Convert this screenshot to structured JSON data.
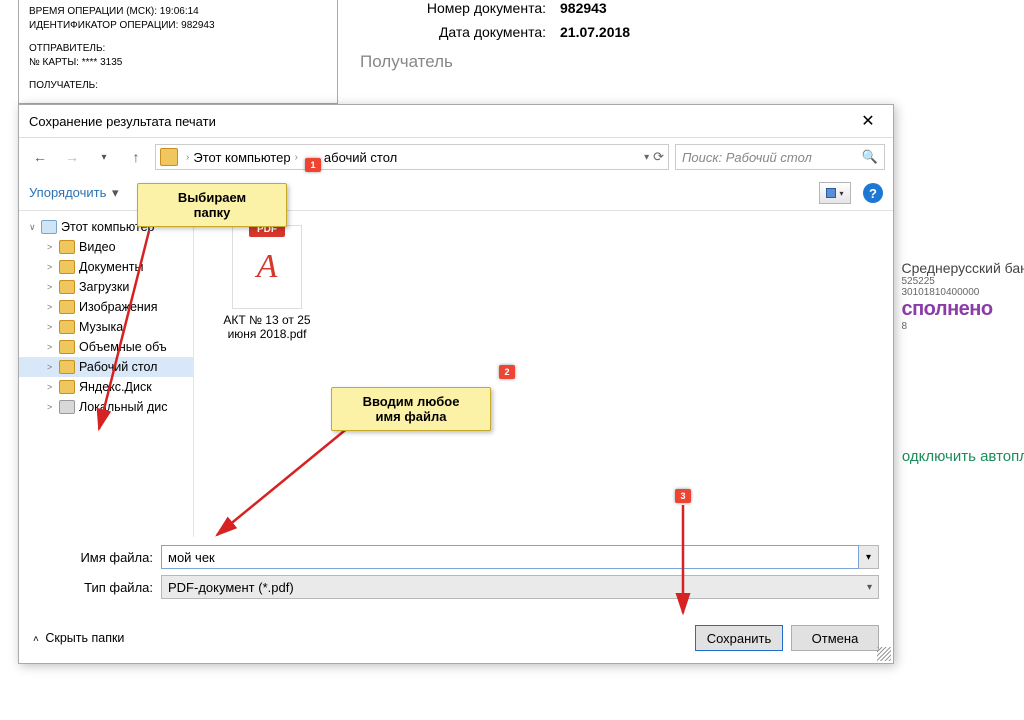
{
  "background": {
    "left_lines": {
      "time_label": "ВРЕМЯ ОПЕРАЦИИ (МСК): 19:06:14",
      "id_label": "ИДЕНТИФИКАТОР ОПЕРАЦИИ: 982943",
      "sender_label": "ОТПРАВИТЕЛЬ:",
      "card_label": "№ КАРТЫ: **** 3135",
      "recipient_label": "ПОЛУЧАТЕЛЬ:"
    },
    "right": {
      "doc_num_label": "Номер документа:",
      "doc_num": "982943",
      "doc_date_label": "Дата документа:",
      "doc_date": "21.07.2018",
      "recipient_heading": "Получатель"
    },
    "stamp": {
      "bank": "Среднерусский банк",
      "bic": "525225",
      "acct": "30101810400000",
      "status": "сполнено",
      "code": "8"
    },
    "autolink": "одключить автопл"
  },
  "dialog": {
    "title": "Сохранение результата печати",
    "breadcrumb": {
      "root": "Этот компьютер",
      "current": "абочий стол"
    },
    "search_placeholder": "Поиск: Рабочий стол",
    "organize": "Упорядочить",
    "tree": [
      {
        "label": "Этот компьютер",
        "icon": "pc",
        "caret": "∨",
        "lvl": 1
      },
      {
        "label": "Видео",
        "icon": "f",
        "caret": ">",
        "lvl": 2
      },
      {
        "label": "Документы",
        "icon": "f",
        "caret": ">",
        "lvl": 2
      },
      {
        "label": "Загрузки",
        "icon": "f",
        "caret": ">",
        "lvl": 2
      },
      {
        "label": "Изображения",
        "icon": "f",
        "caret": ">",
        "lvl": 2
      },
      {
        "label": "Музыка",
        "icon": "f",
        "caret": ">",
        "lvl": 2
      },
      {
        "label": "Объемные объ",
        "icon": "f",
        "caret": ">",
        "lvl": 2
      },
      {
        "label": "Рабочий стол",
        "icon": "f",
        "caret": ">",
        "lvl": 2,
        "selected": true
      },
      {
        "label": "Яндекс.Диск",
        "icon": "f",
        "caret": ">",
        "lvl": 2
      },
      {
        "label": "Локальный дис",
        "icon": "disk",
        "caret": ">",
        "lvl": 2
      }
    ],
    "file": {
      "badge": "PDF",
      "name_l1": "АКТ № 13 от 25",
      "name_l2": "июня 2018.pdf"
    },
    "filename_label": "Имя файла:",
    "filename_value": "мой чек",
    "filetype_label": "Тип файла:",
    "filetype_value": "PDF-документ (*.pdf)",
    "hide_folders": "Скрыть папки",
    "save_btn": "Сохранить",
    "cancel_btn": "Отмена"
  },
  "annotations": {
    "callout1_l1": "Выбираем",
    "callout1_l2": "папку",
    "callout2_l1": "Вводим любое",
    "callout2_l2": "имя файла",
    "n1": "1",
    "n2": "2",
    "n3": "3"
  }
}
